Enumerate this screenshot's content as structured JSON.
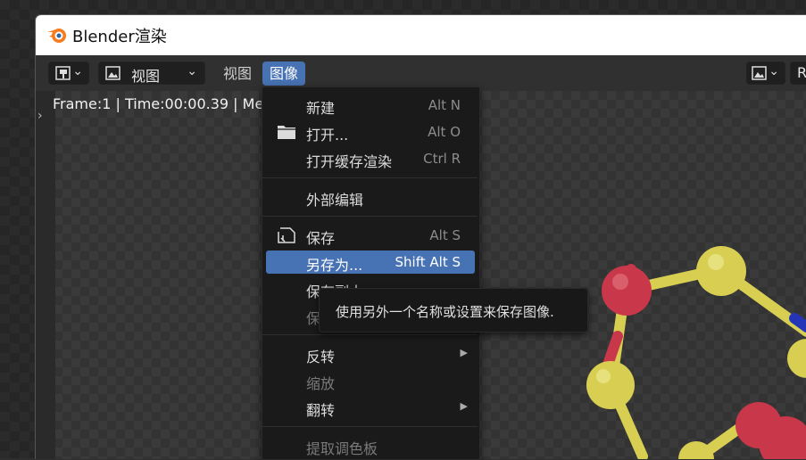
{
  "window": {
    "title": "Blender渲染"
  },
  "header": {
    "view_dropdown_label": "视图",
    "menus": [
      {
        "label": "视图"
      },
      {
        "label": "图像"
      }
    ],
    "right_label": "R"
  },
  "viewport": {
    "info": "Frame:1 | Time:00:00.39 | Me"
  },
  "image_menu": {
    "items": [
      {
        "label": "新建",
        "shortcut": "Alt N"
      },
      {
        "label": "打开...",
        "shortcut": "Alt O",
        "icon": "folder-icon"
      },
      {
        "label": "打开缓存渲染",
        "shortcut": "Ctrl R"
      },
      {
        "label": "外部编辑"
      },
      {
        "label": "保存",
        "shortcut": "Alt S",
        "icon": "save-icon"
      },
      {
        "label": "另存为...",
        "shortcut": "Shift Alt S",
        "highlighted": true
      },
      {
        "label": "保存副本"
      },
      {
        "label": "保",
        "disabled": true
      },
      {
        "label": "反转",
        "submenu": true
      },
      {
        "label": "缩放",
        "disabled": true
      },
      {
        "label": "翻转",
        "submenu": true
      },
      {
        "label": "提取调色板",
        "disabled": true
      }
    ]
  },
  "tooltip": {
    "text": "使用另外一个名称或设置来保存图像."
  },
  "colors": {
    "accent": "#4772b3",
    "menu_bg": "#1a1a1a",
    "atom_red": "#c8374a",
    "atom_yellow": "#d8cf52"
  }
}
